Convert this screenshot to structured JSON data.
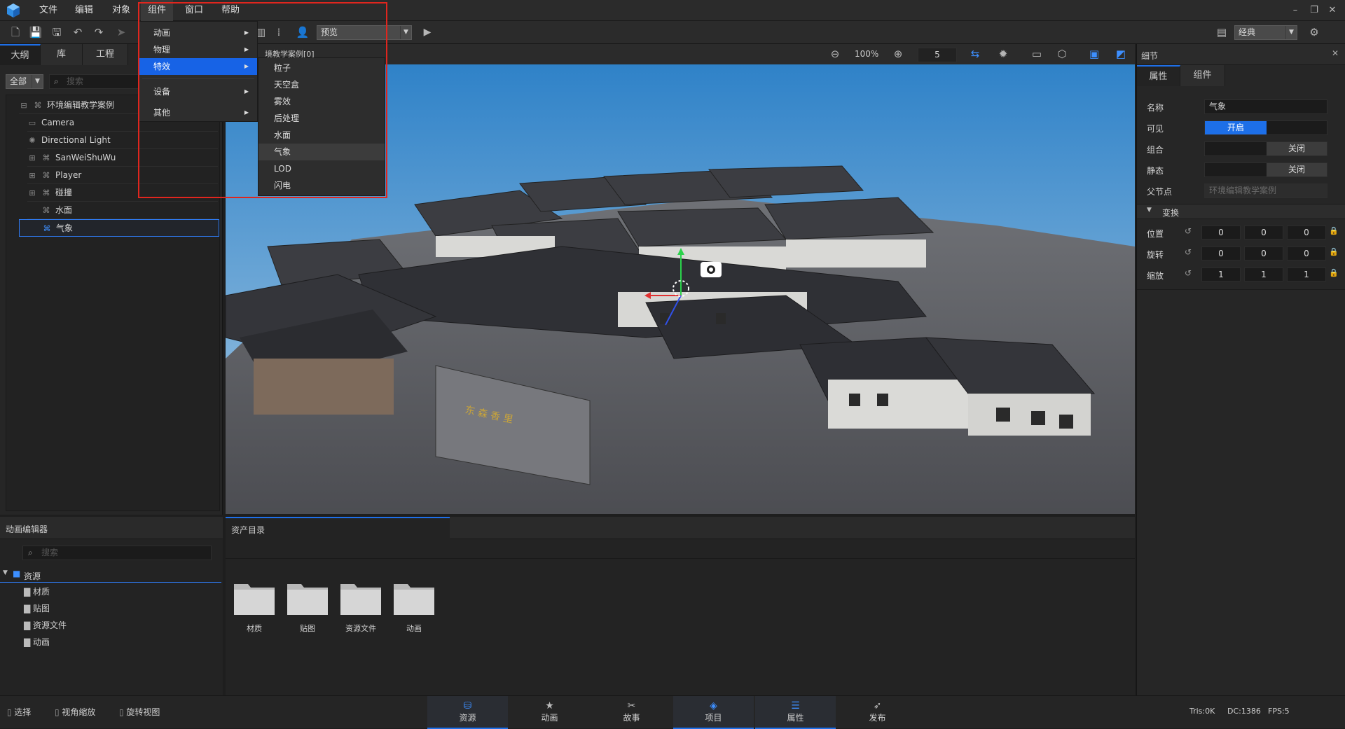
{
  "menubar": {
    "items": [
      "文件",
      "编辑",
      "对象",
      "组件",
      "窗口",
      "帮助"
    ],
    "active_index": 3
  },
  "toolbar": {
    "preview_select": "预览",
    "layout_select": "经典"
  },
  "left_panel": {
    "tabs": [
      "大纲",
      "库",
      "工程"
    ],
    "filter": "全部",
    "search_placeholder": "搜索",
    "tree": {
      "root": "环境编辑教学案例",
      "children": [
        "Camera",
        "Directional Light",
        "SanWeiShuWu",
        "Player",
        "碰撞",
        "水面",
        "气象"
      ],
      "selected_index": 6
    }
  },
  "viewport": {
    "title_fragment": "境教学案例[0]",
    "zoom": "100%",
    "grid_value": "5",
    "sign_text": "东 森 香 里"
  },
  "component_menu": {
    "items": [
      "动画",
      "物理",
      "特效",
      "设备",
      "其他"
    ],
    "highlighted_index": 2,
    "submenu": [
      "粒子",
      "天空盒",
      "雾效",
      "后处理",
      "水面",
      "气象",
      "LOD",
      "闪电"
    ],
    "submenu_hover_index": 5
  },
  "detail_panel": {
    "title": "细节",
    "tabs": [
      "属性",
      "组件"
    ],
    "name_label": "名称",
    "name_value": "气象",
    "visible_label": "可见",
    "visible_value": "开启",
    "group_label": "组合",
    "group_value": "关闭",
    "static_label": "静态",
    "static_value": "关闭",
    "parent_label": "父节点",
    "parent_value": "环境编辑教学案例",
    "transform_section": "变换",
    "position_label": "位置",
    "position": [
      "0",
      "0",
      "0"
    ],
    "rotation_label": "旋转",
    "rotation": [
      "0",
      "0",
      "0"
    ],
    "scale_label": "缩放",
    "scale": [
      "1",
      "1",
      "1"
    ]
  },
  "anim_panel": {
    "title": "动画编辑器",
    "search_placeholder": "搜索",
    "tree_root": "资源",
    "tree_items": [
      "材质",
      "贴图",
      "资源文件",
      "动画"
    ]
  },
  "asset_panel": {
    "tab": "资产目录",
    "folders": [
      "材质",
      "贴图",
      "资源文件",
      "动画"
    ]
  },
  "statusbar": {
    "left_items": [
      "选择",
      "视角缩放",
      "旋转视图"
    ],
    "tabs": [
      "资源",
      "动画",
      "故事",
      "项目",
      "属性",
      "发布"
    ],
    "active_tabs": [
      3,
      4
    ],
    "tris": "Tris:0K",
    "dc": "DC:1386",
    "fps": "FPS:5"
  },
  "colors": {
    "accent": "#1e6fe8",
    "highlight": "#1763e6",
    "annotation": "#e0261e"
  }
}
